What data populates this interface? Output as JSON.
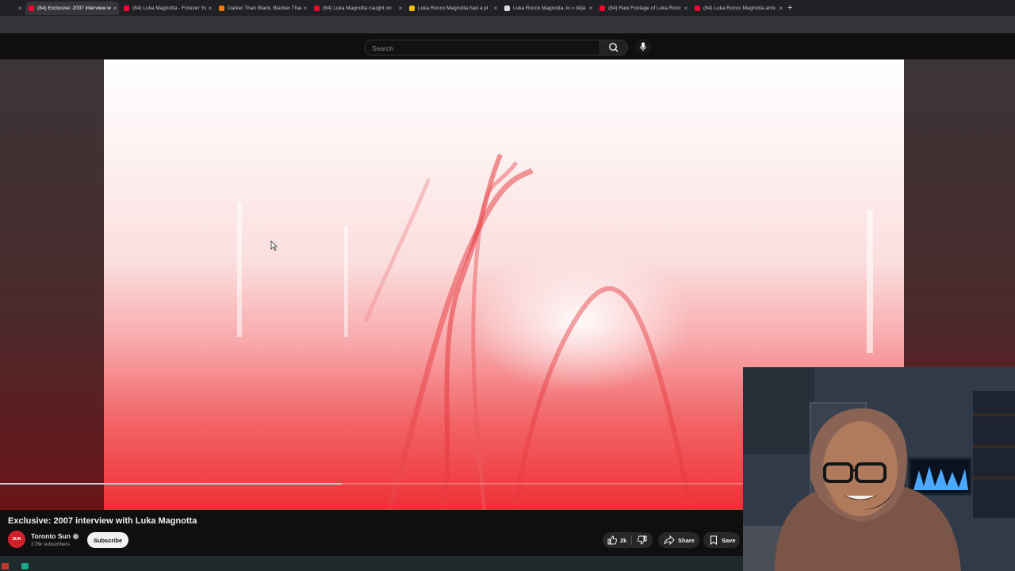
{
  "browser": {
    "tabs": [
      {
        "title": "",
        "icon": "youtube-icon",
        "active": false
      },
      {
        "title": "(84) Exclusive: 2007 interview w",
        "icon": "youtube-icon",
        "active": true
      },
      {
        "title": "(84) Luka Magnotta - Forever Yo",
        "icon": "youtube-icon",
        "active": false
      },
      {
        "title": "Darker Than Black, Blacker Than",
        "icon": "blogger-icon",
        "active": false
      },
      {
        "title": "(84) Luka Magnotta caught on",
        "icon": "youtube-icon",
        "active": false
      },
      {
        "title": "Luka Rocco Magnotta had a pl",
        "icon": "news-icon",
        "active": false
      },
      {
        "title": "Luka Rocco Magnotta, lo « déjà",
        "icon": "medium-icon",
        "active": false
      },
      {
        "title": "(84) Raw Footage of Luka Rocc",
        "icon": "youtube-icon",
        "active": false
      },
      {
        "title": "(84) Luka Rocco Magnotta arriv",
        "icon": "youtube-icon",
        "active": false
      }
    ],
    "new_tab": "+"
  },
  "header": {
    "search_placeholder": "Search",
    "search_icon": "search-icon",
    "mic_icon": "microphone-icon"
  },
  "player": {
    "progress_fraction": 0.46,
    "accent": "#ff0033"
  },
  "video": {
    "title": "Exclusive: 2007 interview with Luka Magnotta",
    "channel": {
      "name": "Toronto Sun",
      "avatar_text": "SUN",
      "subscribers": "278k subscribers"
    },
    "subscribe_label": "Subscribe",
    "actions": {
      "like_count": "2k",
      "share_label": "Share",
      "save_label": "Save"
    }
  },
  "colors": {
    "background": "#0f0f0f",
    "channel_avatar": "#d0212a",
    "subscribe_bg": "#f1f1f1"
  }
}
